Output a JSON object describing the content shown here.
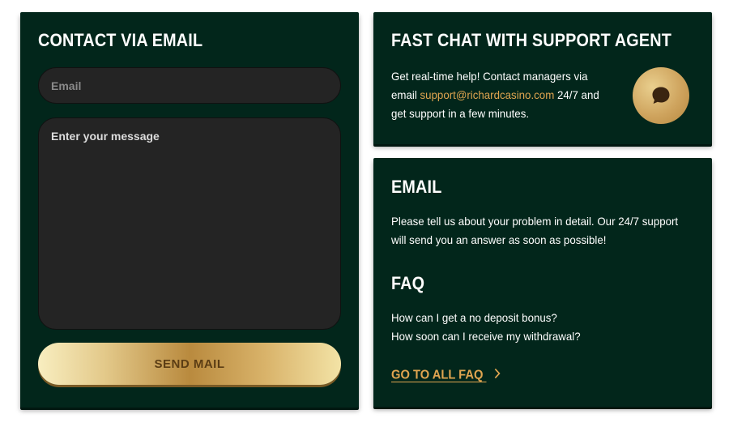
{
  "contact_form": {
    "title": "CONTACT VIA EMAIL",
    "email_placeholder": "Email",
    "message_placeholder": "Enter your message",
    "send_label": "SEND MAIL"
  },
  "fast_chat": {
    "title": "FAST CHAT WITH SUPPORT AGENT",
    "text_line1": "Get real-time help! Contact managers via",
    "text_line2_prefix": "email ",
    "support_email": "support@richardcasino.com",
    "text_line2_suffix": " 24/7 and",
    "text_line3": "get support in a few minutes.",
    "chat_icon": "chat-bubble-icon"
  },
  "email_info": {
    "title": "EMAIL",
    "text_line1": "Please tell us about your problem in detail. Our 24/7 support",
    "text_line2": "will send you an answer as soon as possible!"
  },
  "faq": {
    "title": "FAQ",
    "questions": [
      "How can I get a no deposit bonus?",
      "How soon can I receive my withdrawal?"
    ],
    "link_label": "GO TO ALL FAQ",
    "link_icon": "chevron-right-icon"
  },
  "colors": {
    "card_background": "#02261b",
    "accent_gold": "#e0a550",
    "input_background": "#242424"
  }
}
